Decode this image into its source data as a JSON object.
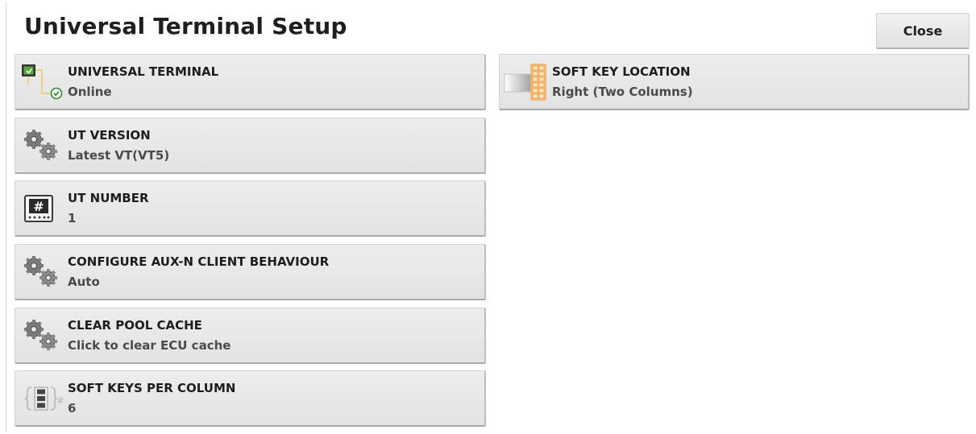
{
  "header": {
    "title": "Universal Terminal Setup",
    "close_label": "Close"
  },
  "settings": [
    {
      "label": "UNIVERSAL TERMINAL",
      "value": "Online",
      "icon": "terminal-online-icon"
    },
    {
      "label": "UT VERSION",
      "value": "Latest VT(VT5)",
      "icon": "gears-icon"
    },
    {
      "label": "UT NUMBER",
      "value": "1",
      "icon": "terminal-number-icon"
    },
    {
      "label": "CONFIGURE AUX-N CLIENT BEHAVIOUR",
      "value": "Auto",
      "icon": "gears-icon"
    },
    {
      "label": "CLEAR POOL CACHE",
      "value": "Click to clear ECU cache",
      "icon": "gears-icon"
    },
    {
      "label": "SOFT KEYS PER COLUMN",
      "value": "6",
      "icon": "soft-keys-column-icon"
    },
    {
      "label": "SOFT KEY LOCATION",
      "value": "Right (Two Columns)",
      "icon": "soft-key-location-icon"
    }
  ],
  "colors": {
    "tile_background": "#e8e8e8",
    "status_ok": "#2e8b2e",
    "highlight": "#f2a24a"
  }
}
